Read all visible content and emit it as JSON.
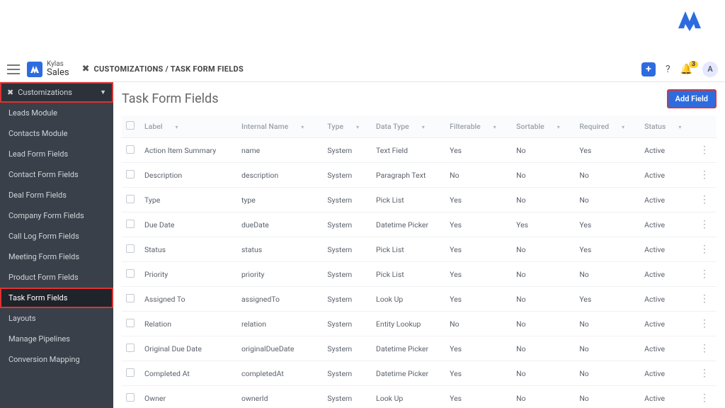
{
  "brand": {
    "name": "Kylas",
    "sub": "Sales",
    "initial": "A"
  },
  "header": {
    "breadcrumb": "CUSTOMIZATIONS / TASK FORM FIELDS",
    "notifications": "3",
    "avatar": "A"
  },
  "sidebar": {
    "heading": "Customizations",
    "items": [
      {
        "label": "Leads Module"
      },
      {
        "label": "Contacts Module"
      },
      {
        "label": "Lead Form Fields"
      },
      {
        "label": "Contact Form Fields"
      },
      {
        "label": "Deal Form Fields"
      },
      {
        "label": "Company Form Fields"
      },
      {
        "label": "Call Log Form Fields"
      },
      {
        "label": "Meeting Form Fields"
      },
      {
        "label": "Product Form Fields"
      },
      {
        "label": "Task Form Fields",
        "active": true
      },
      {
        "label": "Layouts"
      },
      {
        "label": "Manage Pipelines"
      },
      {
        "label": "Conversion Mapping"
      }
    ]
  },
  "page": {
    "title": "Task Form Fields",
    "add_button": "Add Field"
  },
  "table": {
    "columns": [
      "Label",
      "Internal Name",
      "Type",
      "Data Type",
      "Filterable",
      "Sortable",
      "Required",
      "Status"
    ],
    "rows": [
      {
        "label": "Action Item Summary",
        "internal": "name",
        "type": "System",
        "dataType": "Text Field",
        "filterable": "Yes",
        "sortable": "No",
        "required": "Yes",
        "status": "Active"
      },
      {
        "label": "Description",
        "internal": "description",
        "type": "System",
        "dataType": "Paragraph Text",
        "filterable": "No",
        "sortable": "No",
        "required": "No",
        "status": "Active"
      },
      {
        "label": "Type",
        "internal": "type",
        "type": "System",
        "dataType": "Pick List",
        "filterable": "Yes",
        "sortable": "No",
        "required": "No",
        "status": "Active"
      },
      {
        "label": "Due Date",
        "internal": "dueDate",
        "type": "System",
        "dataType": "Datetime Picker",
        "filterable": "Yes",
        "sortable": "Yes",
        "required": "Yes",
        "status": "Active"
      },
      {
        "label": "Status",
        "internal": "status",
        "type": "System",
        "dataType": "Pick List",
        "filterable": "Yes",
        "sortable": "No",
        "required": "Yes",
        "status": "Active"
      },
      {
        "label": "Priority",
        "internal": "priority",
        "type": "System",
        "dataType": "Pick List",
        "filterable": "Yes",
        "sortable": "No",
        "required": "No",
        "status": "Active"
      },
      {
        "label": "Assigned To",
        "internal": "assignedTo",
        "type": "System",
        "dataType": "Look Up",
        "filterable": "Yes",
        "sortable": "No",
        "required": "Yes",
        "status": "Active"
      },
      {
        "label": "Relation",
        "internal": "relation",
        "type": "System",
        "dataType": "Entity Lookup",
        "filterable": "No",
        "sortable": "No",
        "required": "No",
        "status": "Active"
      },
      {
        "label": "Original Due Date",
        "internal": "originalDueDate",
        "type": "System",
        "dataType": "Datetime Picker",
        "filterable": "Yes",
        "sortable": "No",
        "required": "No",
        "status": "Active"
      },
      {
        "label": "Completed At",
        "internal": "completedAt",
        "type": "System",
        "dataType": "Datetime Picker",
        "filterable": "Yes",
        "sortable": "No",
        "required": "No",
        "status": "Active"
      },
      {
        "label": "Owner",
        "internal": "ownerId",
        "type": "System",
        "dataType": "Look Up",
        "filterable": "Yes",
        "sortable": "No",
        "required": "No",
        "status": "Active"
      }
    ]
  }
}
